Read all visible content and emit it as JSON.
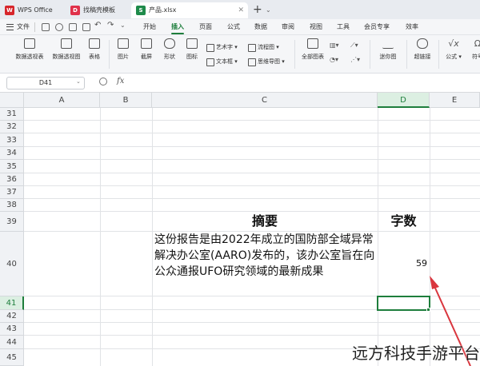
{
  "tabs": [
    {
      "label": "WPS Office",
      "icon": "W",
      "color": "#d7262b"
    },
    {
      "label": "找稿壳模板",
      "icon": "D",
      "color": "#e0314a"
    },
    {
      "label": "产品.xlsx",
      "icon": "S",
      "color": "#1e8a4a"
    }
  ],
  "new_tab_symbol": "+",
  "menu": {
    "file": "文件",
    "items": [
      "开始",
      "插入",
      "页面",
      "公式",
      "数据",
      "审阅",
      "视图",
      "工具",
      "会员专享",
      "效率"
    ],
    "active": "插入"
  },
  "ribbon": {
    "pivot_table": "数据透视表",
    "pivot_chart": "数据透视图",
    "table": "表格",
    "picture": "图片",
    "screenshot": "截屏",
    "shapes": "形状",
    "icons": "图标",
    "wordart": "艺术字",
    "textbox": "文本框",
    "flowchart": "流程图",
    "mindmap": "思维导图",
    "all_charts": "全部图表",
    "sparkline": "迷你图",
    "hyperlink": "超链接",
    "formula": "公式",
    "symbol": "符号"
  },
  "formula_bar": {
    "name_box": "D41",
    "fx": "fx",
    "value": ""
  },
  "columns": [
    "A",
    "B",
    "C",
    "D",
    "E"
  ],
  "selected_column": "D",
  "rows": [
    "31",
    "32",
    "33",
    "34",
    "35",
    "36",
    "37",
    "38",
    "39",
    "40",
    "41",
    "42",
    "43",
    "44",
    "45"
  ],
  "selected_row": "41",
  "cells": {
    "c39": "摘要",
    "d39": "字数",
    "c40": "这份报告是由2022年成立的国防部全域异常解决办公室(AARO)发布的，该办公室旨在向公众通报UFO研究领域的最新成果",
    "d40": "59"
  },
  "selected_cell": "D41",
  "annotation_color": "#d9363e",
  "watermark": "远方科技手游平台"
}
